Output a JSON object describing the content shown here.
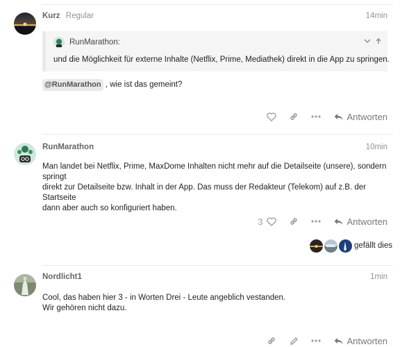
{
  "posts": [
    {
      "username": "Kurz",
      "user_title": "Regular",
      "time": "14min",
      "quote": {
        "author": "RunMarathon:",
        "text": "und die Möglichkeit für externe Inhalte (Netflix, Prime, Mediathek) direkt in die App zu springen."
      },
      "mention": "@RunMarathon",
      "text_after_mention": ", wie ist das gemeint?",
      "reply_label": "Antworten"
    },
    {
      "username": "RunMarathon",
      "time": "10min",
      "lines": [
        "Man landet bei Netflix, Prime, MaxDome Inhalten nicht mehr auf die Detailseite (unsere), sondern springt",
        "direkt zur Detailseite bzw. Inhalt in der App. Das muss der Redakteur (Telekom) auf z.B. der Startseite",
        "dann aber auch so konfiguriert haben."
      ],
      "like_count": "3",
      "reply_label": "Antworten",
      "likers_text": "gefällt dies"
    },
    {
      "username": "Nordlicht1",
      "time": "1min",
      "lines": [
        "Cool, das haben hier 3 - in Worten Drei - Leute angeblich vestanden.",
        "Wir gehören nicht dazu."
      ],
      "reply_label": "Antworten"
    }
  ],
  "icons": {
    "like": "heart-icon",
    "link": "link-icon",
    "more": "ellipsis-icon",
    "reply": "reply-arrow-icon",
    "edit": "pencil-icon",
    "expand": "chevron-down-icon",
    "jump": "arrow-up-icon"
  },
  "colors": {
    "muted": "#919191",
    "icon": "#9e9e9e",
    "quote_bg": "#f5f5f5",
    "mention_bg": "#e9e9e9"
  }
}
